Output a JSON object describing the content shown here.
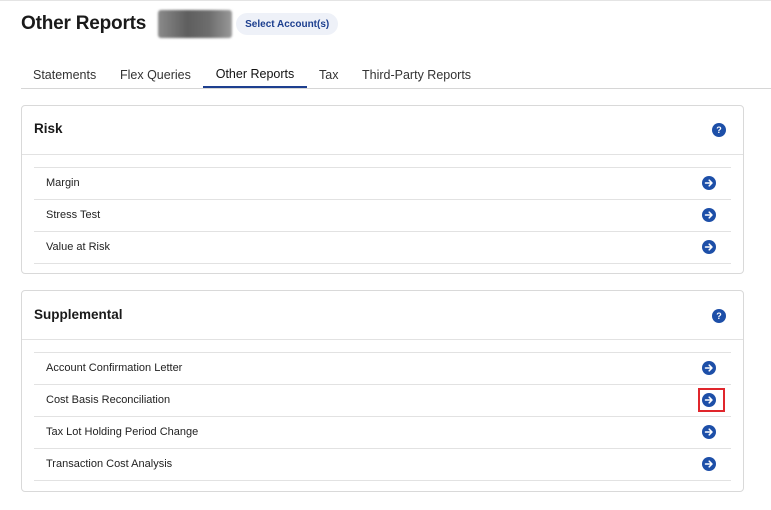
{
  "header": {
    "title": "Other Reports",
    "select_account_label": "Select Account(s)"
  },
  "tabs": [
    {
      "label": "Statements",
      "active": false
    },
    {
      "label": "Flex Queries",
      "active": false
    },
    {
      "label": "Other Reports",
      "active": true
    },
    {
      "label": "Tax",
      "active": false
    },
    {
      "label": "Third-Party Reports",
      "active": false
    }
  ],
  "sections": [
    {
      "title": "Risk",
      "help_icon": "question-mark",
      "items": [
        {
          "label": "Margin",
          "icon": "arrow-right-circle"
        },
        {
          "label": "Stress Test",
          "icon": "arrow-right-circle"
        },
        {
          "label": "Value at Risk",
          "icon": "arrow-right-circle"
        }
      ]
    },
    {
      "title": "Supplemental",
      "help_icon": "question-mark",
      "items": [
        {
          "label": "Account Confirmation Letter",
          "icon": "arrow-right-circle"
        },
        {
          "label": "Cost Basis Reconciliation",
          "icon": "arrow-right-circle",
          "highlighted": true
        },
        {
          "label": "Tax Lot Holding Period Change",
          "icon": "arrow-right-circle"
        },
        {
          "label": "Transaction Cost Analysis",
          "icon": "arrow-right-circle"
        }
      ]
    }
  ],
  "colors": {
    "accent": "#1d4fa8",
    "tab_underline": "#1d3f8f",
    "highlight_box": "#e0262c"
  }
}
